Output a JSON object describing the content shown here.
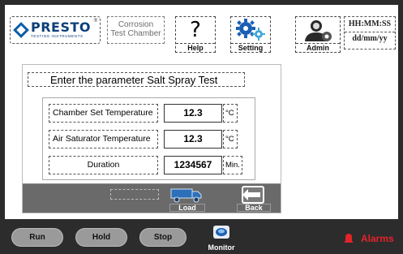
{
  "header": {
    "logo_text": "PRESTO",
    "logo_tagline": "TESTING INSTRUMENTS",
    "logo_registered": "®",
    "title_line1": "Corrosion",
    "title_line2": "Test Chamber",
    "help_label": "Help",
    "help_glyph": "?",
    "setting_label": "Setting",
    "admin_label": "Admin",
    "time": "HH:MM:SS",
    "date": "dd/mm/yy"
  },
  "panel": {
    "heading": "Enter the parameter Salt Spray Test",
    "rows": [
      {
        "label": "Chamber Set Temperature",
        "value": "12.3",
        "unit": "°C"
      },
      {
        "label": "Air Saturator Temperature",
        "value": "12.3",
        "unit": "°C"
      },
      {
        "label": "Duration",
        "value": "1234567",
        "unit": "Min."
      }
    ],
    "load_label": "Load",
    "back_label": "Back"
  },
  "bottom": {
    "run_label": "Run",
    "hold_label": "Hold",
    "stop_label": "Stop",
    "monitor_label": "Monitor",
    "alarms_label": "Alarms"
  },
  "colors": {
    "brand_blue": "#0c3f7a",
    "alarm_red": "#e3232a",
    "bar_dark": "#2c2c2c",
    "panel_footer": "#6a6a6a"
  },
  "icons": {
    "help": "question-icon",
    "setting": "gears-icon",
    "admin": "admin-user-icon",
    "load": "truck-icon",
    "back": "back-arrow-icon",
    "monitor": "monitor-icon",
    "alarms": "alarm-bell-icon"
  }
}
